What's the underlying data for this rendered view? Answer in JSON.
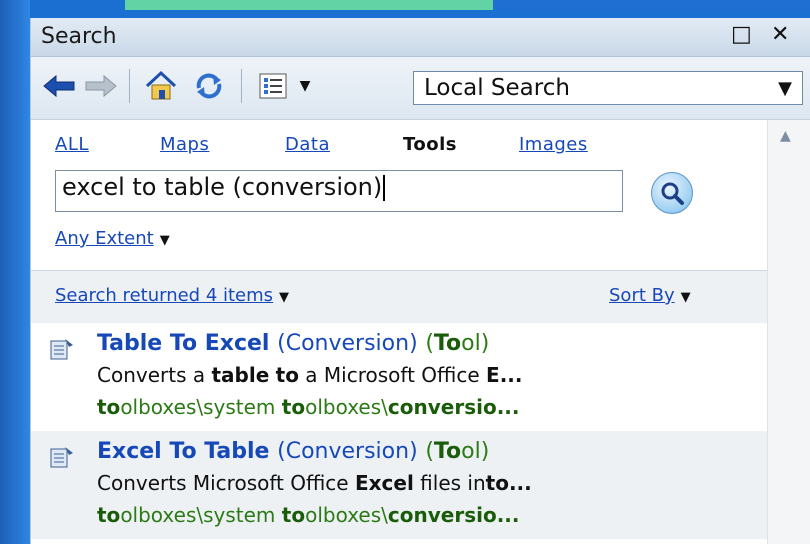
{
  "window": {
    "title": "Search"
  },
  "controls": {
    "maximize_glyph": "□",
    "close_glyph": "✕"
  },
  "toolbar": {
    "icons": [
      "back-arrow-icon",
      "forward-arrow-icon",
      "home-icon",
      "refresh-icon",
      "list-view-icon"
    ],
    "location": "Local Search"
  },
  "tabs": [
    {
      "label": "ALL",
      "active": false
    },
    {
      "label": "Maps",
      "active": false
    },
    {
      "label": "Data",
      "active": false
    },
    {
      "label": "Tools",
      "active": true
    },
    {
      "label": "Images",
      "active": false
    }
  ],
  "search": {
    "query": "excel to table (conversion)"
  },
  "extent": {
    "label": "Any Extent"
  },
  "summary": {
    "label": "Search returned 4 items",
    "sort_label": "Sort By"
  },
  "results": [
    {
      "title_main": "Table To Excel",
      "title_paren": "(Conversion)",
      "kind_open": "(",
      "kind_bold": "To",
      "kind_rest": "ol)",
      "desc_1": "Converts a ",
      "desc_b1": "table",
      "desc_2": " ",
      "desc_b2": "to",
      "desc_3": " a Microsoft Office ",
      "desc_b3": "E...",
      "path_b1": "to",
      "path_1": "olboxes\\system ",
      "path_b2": "to",
      "path_2": "olboxes\\",
      "path_b3": "conversio..."
    },
    {
      "title_main": "Excel To Table",
      "title_paren": "(Conversion)",
      "kind_open": "(",
      "kind_bold": "To",
      "kind_rest": "ol)",
      "desc_1": "Converts Microsoft Office ",
      "desc_b1": "Excel",
      "desc_2": " files in",
      "desc_b2": "to...",
      "desc_3": "",
      "desc_b3": "",
      "path_b1": "to",
      "path_1": "olboxes\\system ",
      "path_b2": "to",
      "path_2": "olboxes\\",
      "path_b3": "conversio..."
    }
  ],
  "colors": {
    "link": "#1648b8",
    "path_green": "#2c7a16",
    "bg_blue": "#1a6fd0"
  }
}
